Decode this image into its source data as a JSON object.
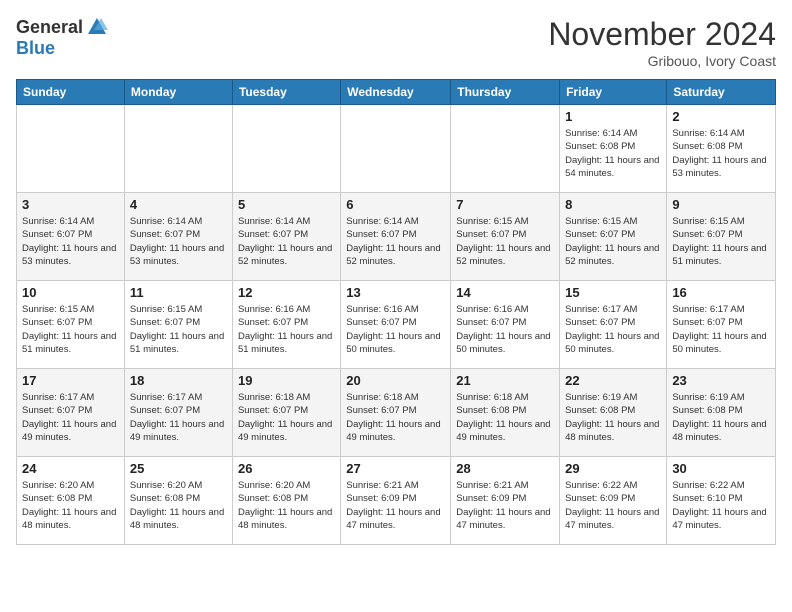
{
  "header": {
    "logo_general": "General",
    "logo_blue": "Blue",
    "month": "November 2024",
    "location": "Gribouo, Ivory Coast"
  },
  "days_of_week": [
    "Sunday",
    "Monday",
    "Tuesday",
    "Wednesday",
    "Thursday",
    "Friday",
    "Saturday"
  ],
  "weeks": [
    [
      {
        "day": "",
        "sunrise": "",
        "sunset": "",
        "daylight": ""
      },
      {
        "day": "",
        "sunrise": "",
        "sunset": "",
        "daylight": ""
      },
      {
        "day": "",
        "sunrise": "",
        "sunset": "",
        "daylight": ""
      },
      {
        "day": "",
        "sunrise": "",
        "sunset": "",
        "daylight": ""
      },
      {
        "day": "",
        "sunrise": "",
        "sunset": "",
        "daylight": ""
      },
      {
        "day": "1",
        "sunrise": "Sunrise: 6:14 AM",
        "sunset": "Sunset: 6:08 PM",
        "daylight": "Daylight: 11 hours and 54 minutes."
      },
      {
        "day": "2",
        "sunrise": "Sunrise: 6:14 AM",
        "sunset": "Sunset: 6:08 PM",
        "daylight": "Daylight: 11 hours and 53 minutes."
      }
    ],
    [
      {
        "day": "3",
        "sunrise": "Sunrise: 6:14 AM",
        "sunset": "Sunset: 6:07 PM",
        "daylight": "Daylight: 11 hours and 53 minutes."
      },
      {
        "day": "4",
        "sunrise": "Sunrise: 6:14 AM",
        "sunset": "Sunset: 6:07 PM",
        "daylight": "Daylight: 11 hours and 53 minutes."
      },
      {
        "day": "5",
        "sunrise": "Sunrise: 6:14 AM",
        "sunset": "Sunset: 6:07 PM",
        "daylight": "Daylight: 11 hours and 52 minutes."
      },
      {
        "day": "6",
        "sunrise": "Sunrise: 6:14 AM",
        "sunset": "Sunset: 6:07 PM",
        "daylight": "Daylight: 11 hours and 52 minutes."
      },
      {
        "day": "7",
        "sunrise": "Sunrise: 6:15 AM",
        "sunset": "Sunset: 6:07 PM",
        "daylight": "Daylight: 11 hours and 52 minutes."
      },
      {
        "day": "8",
        "sunrise": "Sunrise: 6:15 AM",
        "sunset": "Sunset: 6:07 PM",
        "daylight": "Daylight: 11 hours and 52 minutes."
      },
      {
        "day": "9",
        "sunrise": "Sunrise: 6:15 AM",
        "sunset": "Sunset: 6:07 PM",
        "daylight": "Daylight: 11 hours and 51 minutes."
      }
    ],
    [
      {
        "day": "10",
        "sunrise": "Sunrise: 6:15 AM",
        "sunset": "Sunset: 6:07 PM",
        "daylight": "Daylight: 11 hours and 51 minutes."
      },
      {
        "day": "11",
        "sunrise": "Sunrise: 6:15 AM",
        "sunset": "Sunset: 6:07 PM",
        "daylight": "Daylight: 11 hours and 51 minutes."
      },
      {
        "day": "12",
        "sunrise": "Sunrise: 6:16 AM",
        "sunset": "Sunset: 6:07 PM",
        "daylight": "Daylight: 11 hours and 51 minutes."
      },
      {
        "day": "13",
        "sunrise": "Sunrise: 6:16 AM",
        "sunset": "Sunset: 6:07 PM",
        "daylight": "Daylight: 11 hours and 50 minutes."
      },
      {
        "day": "14",
        "sunrise": "Sunrise: 6:16 AM",
        "sunset": "Sunset: 6:07 PM",
        "daylight": "Daylight: 11 hours and 50 minutes."
      },
      {
        "day": "15",
        "sunrise": "Sunrise: 6:17 AM",
        "sunset": "Sunset: 6:07 PM",
        "daylight": "Daylight: 11 hours and 50 minutes."
      },
      {
        "day": "16",
        "sunrise": "Sunrise: 6:17 AM",
        "sunset": "Sunset: 6:07 PM",
        "daylight": "Daylight: 11 hours and 50 minutes."
      }
    ],
    [
      {
        "day": "17",
        "sunrise": "Sunrise: 6:17 AM",
        "sunset": "Sunset: 6:07 PM",
        "daylight": "Daylight: 11 hours and 49 minutes."
      },
      {
        "day": "18",
        "sunrise": "Sunrise: 6:17 AM",
        "sunset": "Sunset: 6:07 PM",
        "daylight": "Daylight: 11 hours and 49 minutes."
      },
      {
        "day": "19",
        "sunrise": "Sunrise: 6:18 AM",
        "sunset": "Sunset: 6:07 PM",
        "daylight": "Daylight: 11 hours and 49 minutes."
      },
      {
        "day": "20",
        "sunrise": "Sunrise: 6:18 AM",
        "sunset": "Sunset: 6:07 PM",
        "daylight": "Daylight: 11 hours and 49 minutes."
      },
      {
        "day": "21",
        "sunrise": "Sunrise: 6:18 AM",
        "sunset": "Sunset: 6:08 PM",
        "daylight": "Daylight: 11 hours and 49 minutes."
      },
      {
        "day": "22",
        "sunrise": "Sunrise: 6:19 AM",
        "sunset": "Sunset: 6:08 PM",
        "daylight": "Daylight: 11 hours and 48 minutes."
      },
      {
        "day": "23",
        "sunrise": "Sunrise: 6:19 AM",
        "sunset": "Sunset: 6:08 PM",
        "daylight": "Daylight: 11 hours and 48 minutes."
      }
    ],
    [
      {
        "day": "24",
        "sunrise": "Sunrise: 6:20 AM",
        "sunset": "Sunset: 6:08 PM",
        "daylight": "Daylight: 11 hours and 48 minutes."
      },
      {
        "day": "25",
        "sunrise": "Sunrise: 6:20 AM",
        "sunset": "Sunset: 6:08 PM",
        "daylight": "Daylight: 11 hours and 48 minutes."
      },
      {
        "day": "26",
        "sunrise": "Sunrise: 6:20 AM",
        "sunset": "Sunset: 6:08 PM",
        "daylight": "Daylight: 11 hours and 48 minutes."
      },
      {
        "day": "27",
        "sunrise": "Sunrise: 6:21 AM",
        "sunset": "Sunset: 6:09 PM",
        "daylight": "Daylight: 11 hours and 47 minutes."
      },
      {
        "day": "28",
        "sunrise": "Sunrise: 6:21 AM",
        "sunset": "Sunset: 6:09 PM",
        "daylight": "Daylight: 11 hours and 47 minutes."
      },
      {
        "day": "29",
        "sunrise": "Sunrise: 6:22 AM",
        "sunset": "Sunset: 6:09 PM",
        "daylight": "Daylight: 11 hours and 47 minutes."
      },
      {
        "day": "30",
        "sunrise": "Sunrise: 6:22 AM",
        "sunset": "Sunset: 6:10 PM",
        "daylight": "Daylight: 11 hours and 47 minutes."
      }
    ]
  ]
}
